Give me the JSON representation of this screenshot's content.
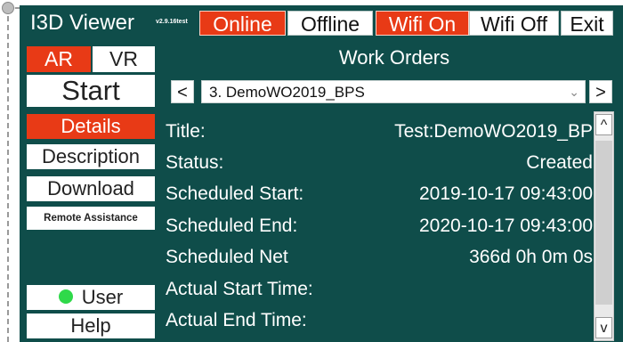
{
  "app": {
    "name": "I3D Viewer",
    "version": "v2.9.16test"
  },
  "topbar": {
    "online": "Online",
    "offline": "Offline",
    "wifi_on": "Wifi On",
    "wifi_off": "Wifi Off",
    "exit": "Exit"
  },
  "left": {
    "ar": "AR",
    "vr": "VR",
    "start": "Start",
    "details": "Details",
    "description": "Description",
    "download": "Download",
    "remote": "Remote Assistance",
    "user": "User",
    "help": "Help"
  },
  "panel": {
    "title": "Work Orders",
    "prev": "<",
    "next": ">",
    "selected_order": "3. DemoWO2019_BPS",
    "rows": [
      {
        "label": "Title:",
        "value": "Test:DemoWO2019_BP"
      },
      {
        "label": "Status:",
        "value": "Created"
      },
      {
        "label": "Scheduled Start:",
        "value": "2019-10-17 09:43:00"
      },
      {
        "label": "Scheduled End:",
        "value": "2020-10-17 09:43:00"
      },
      {
        "label": "Scheduled Net",
        "value": "366d 0h 0m 0s"
      },
      {
        "label": "Actual Start Time:",
        "value": ""
      },
      {
        "label": "Actual End Time:",
        "value": ""
      }
    ],
    "scroll_up": "^",
    "scroll_down": "v"
  },
  "colors": {
    "background": "#0f4d4a",
    "accent": "#e83a16",
    "user_status": "#2fd94a"
  }
}
